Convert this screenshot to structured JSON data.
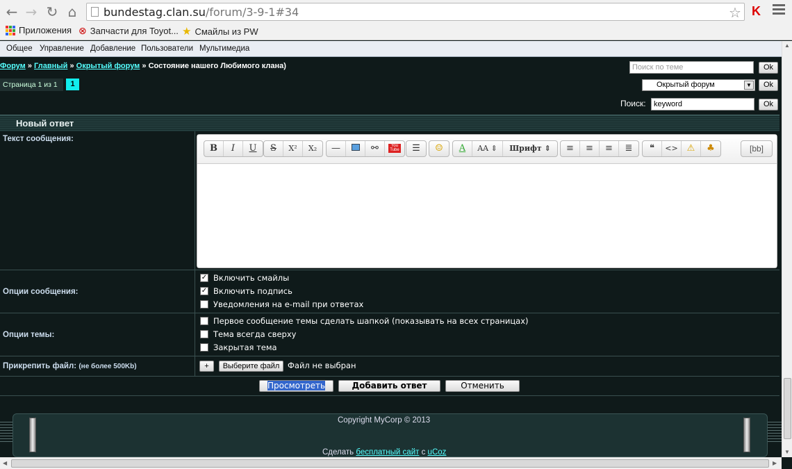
{
  "browser": {
    "url_host": "bundestag.clan.su",
    "url_path": "/forum/3-9-1#34",
    "bookmarks": [
      "Приложения",
      "Запчасти для Toyot...",
      "Смайлы из PW"
    ]
  },
  "topmenu": [
    "Общее",
    "Управление",
    "Добавление",
    "Пользователи",
    "Мультимедиа"
  ],
  "breadcrumb": {
    "items": [
      "Форум",
      "Главный",
      "Окрытый форум"
    ],
    "separator": "»",
    "current": "Состояние нашего Любимого клана)"
  },
  "search_theme_placeholder": "Поиск по теме",
  "ok_label": "Ok",
  "pagination": {
    "label": "Страница 1 из 1",
    "current": "1"
  },
  "forum_select": "Окрытый форум",
  "search": {
    "label": "Поиск:",
    "value": "keyword"
  },
  "form": {
    "title": "Новый ответ",
    "message_label": "Текст сообщения:",
    "message_options_label": "Опции сообщения:",
    "message_options": [
      {
        "label": "Включить смайлы",
        "checked": true
      },
      {
        "label": "Включить подпись",
        "checked": true
      },
      {
        "label": "Уведомления на e-mail при ответах",
        "checked": false
      }
    ],
    "theme_options_label": "Опции темы:",
    "theme_options": [
      {
        "label": "Первое сообщение темы сделать шапкой (показывать на всех страницах)",
        "checked": false
      },
      {
        "label": "Тема всегда сверху",
        "checked": false
      },
      {
        "label": "Закрытая тема",
        "checked": false
      }
    ],
    "attach_label": "Прикрепить файл:",
    "attach_note": "(не более 500Kb)",
    "add_symbol": "+",
    "choose_file": "Выберите файл",
    "no_file": "Файл не выбран",
    "preview": "Просмотреть",
    "submit": "Добавить ответ",
    "cancel": "Отменить"
  },
  "editor": {
    "font_label": "Шрифт",
    "bb_label": "[bb]",
    "buttons": {
      "bold": "B",
      "italic": "I",
      "underline": "U",
      "strike": "S",
      "sup": "X²",
      "sub": "X₂",
      "size": "AA",
      "quote": "❝",
      "code": "<>"
    },
    "youtube_label": "You Tube"
  },
  "footer": {
    "copyright": "Copyright MyCorp © 2013",
    "ucoz_prefix": "Сделать",
    "ucoz_link1": "бесплатный сайт",
    "ucoz_mid": "с",
    "ucoz_link2": "uCoz"
  }
}
